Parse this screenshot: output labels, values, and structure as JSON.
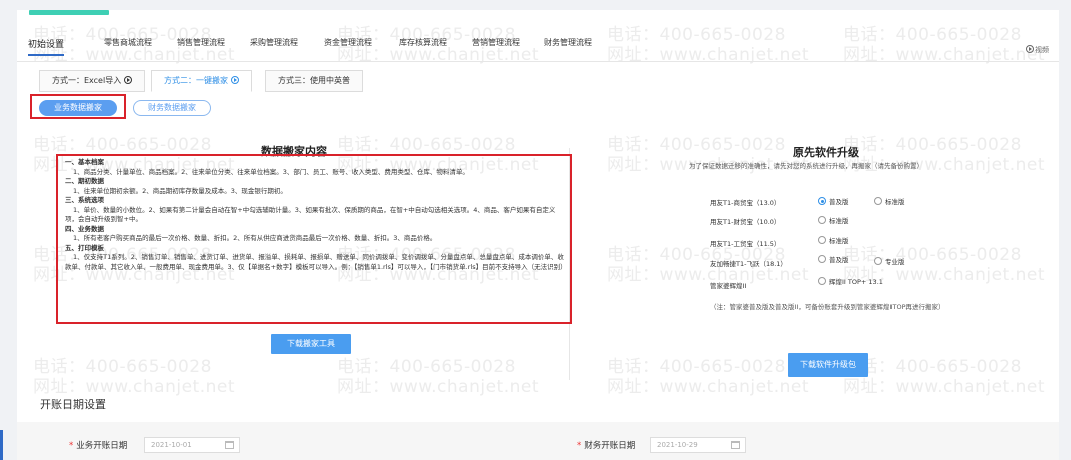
{
  "watermark": {
    "phone": "电话：400-665-0028",
    "site": "网址：www.chanjet.net"
  },
  "main_tabs": [
    {
      "label": "初始设置",
      "active": true
    },
    {
      "label": "零售商城流程",
      "active": false
    },
    {
      "label": "销售管理流程",
      "active": false
    },
    {
      "label": "采购管理流程",
      "active": false
    },
    {
      "label": "资金管理流程",
      "active": false
    },
    {
      "label": "库存核算流程",
      "active": false
    },
    {
      "label": "营销管理流程",
      "active": false
    },
    {
      "label": "财务管理流程",
      "active": false
    }
  ],
  "video_link": "视频",
  "sub_tabs": [
    {
      "label": "方式一：Excel导入",
      "active": false
    },
    {
      "label": "方式二：一键搬家",
      "active": true
    },
    {
      "label": "方式三：使用中英普",
      "active": false
    }
  ],
  "pills": {
    "business": "业务数据搬家",
    "finance": "财务数据搬家"
  },
  "migration": {
    "title": "数据搬家内容",
    "lines": [
      "一、基本档案",
      "1、商品分类、计量单位、商品档案。2、往来单位分类、往来单位档案。3、部门、员工、账号、收入类型、费用类型、仓库、物料清单。",
      "二、期初数据",
      "1、往来单位期初余额。2、商品期初库存数量及成本。3、现金银行期初。",
      "三、系统选项",
      "1、单价、数量的小数位。2、如果有第二计量会自动在智+中勾选辅助计量。3、如果有批次、保质期的商品，在智+中自动勾选相关选项。4、商品、客户如果有自定义项，会自动升级到智+中。",
      "四、业务数据",
      "1、所有老客户购买商品的最后一次价格、数量、折扣。2、所有从供应商进货商品最后一次价格、数量、折扣。3、商品价格。",
      "五、打印模板",
      "1、仅支持T1系列。2、销售订单、销售单、进货订单、进货单、报溢单、损耗单、报损单、赠送单、同价调拨单、变价调拨单、分量盘点单、总量盘点单、成本调价单、收款单、付款单、其它收入单、一般费用单、现金费用单。3、仅【单据名+数字】模板可以导入。例：【销售单1.rls】可以导入，【门市销货单.rls】目前不支持导入（无法识别）"
    ],
    "download_button": "下载搬家工具"
  },
  "upgrade": {
    "title": "原先软件升级",
    "subtitle": "为了保证数据迁移的准确性，请先对您的系统进行升级，再搬家（请先备份购置）",
    "products": [
      {
        "name": "用友T1-商贸宝（13.0）",
        "options": [
          "普及版",
          "标准版"
        ],
        "checked": 0
      },
      {
        "name": "用友T1-财贸宝（10.0）",
        "options": [
          "标准版"
        ],
        "checked": -1
      },
      {
        "name": "用友T1-工贸宝（11.5）",
        "options": [
          "标准版"
        ],
        "checked": -1
      },
      {
        "name": "友加畅捷T1-飞跃（18.1）",
        "options": [
          "普及版",
          "专业版"
        ],
        "checked": -1
      },
      {
        "name": "管家婆辉煌II",
        "options": [
          "辉煌II TOP+ 13.1"
        ],
        "checked": -1
      }
    ],
    "note": "（注：管家婆普及版及普及版II，可备份账套升级到管家婆辉煌ⅡTOP再进行搬家）",
    "download_button": "下载软件升级包"
  },
  "opening_date": {
    "title": "开账日期设置",
    "business_label": "业务开账日期",
    "business_value": "2021-10-01",
    "finance_label": "财务开账日期",
    "finance_value": "2021-10-29",
    "required_mark": "*"
  },
  "colors": {
    "accent": "#3ecfb4",
    "primary": "#2f8fe6",
    "button": "#4a9df0",
    "highlight_box": "#d9222a"
  }
}
